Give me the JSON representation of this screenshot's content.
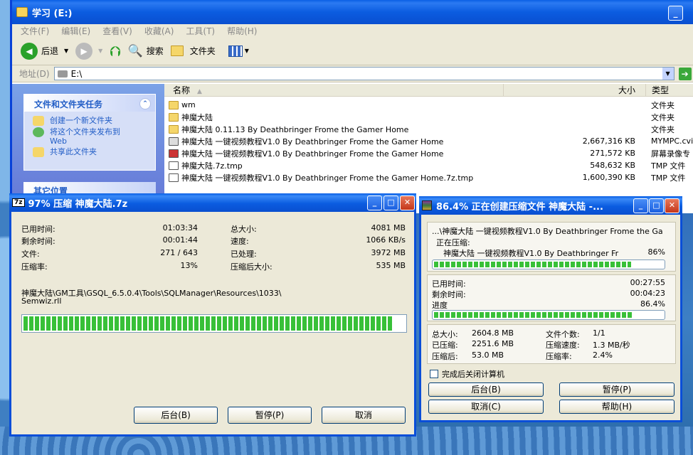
{
  "explorer": {
    "title": "学习 (E:)",
    "menu": [
      "文件(F)",
      "编辑(E)",
      "查看(V)",
      "收藏(A)",
      "工具(T)",
      "帮助(H)"
    ],
    "toolbar": {
      "back": "后退",
      "search": "搜索",
      "folders": "文件夹"
    },
    "address_label": "地址(D)",
    "address_value": "E:\\",
    "tasks": {
      "header": "文件和文件夹任务",
      "items": [
        "创建一个新文件夹",
        "将这个文件夹发布到 Web",
        "共享此文件夹"
      ]
    },
    "other_places": "其它位置",
    "columns": {
      "name": "名称",
      "size": "大小",
      "type": "类型"
    },
    "files": [
      {
        "name": "wm",
        "size": "",
        "type": "文件夹",
        "icon": "folder"
      },
      {
        "name": "神魔大陆",
        "size": "",
        "type": "文件夹",
        "icon": "folder"
      },
      {
        "name": "神魔大陆 0.11.13 By Deathbringer Frome the Gamer Home",
        "size": "",
        "type": "文件夹",
        "icon": "folder"
      },
      {
        "name": "神魔大陆 一键视频教程V1.0 By Deathbringer Frome the Gamer Home",
        "size": "2,667,316 KB",
        "type": "MYMPC.cvi",
        "icon": "video"
      },
      {
        "name": "神魔大陆 一键视频教程V1.0 By Deathbringer Frome the Gamer Home",
        "size": "271,572 KB",
        "type": "屏幕录像专",
        "icon": "video"
      },
      {
        "name": "神魔大陆.7z.tmp",
        "size": "548,632 KB",
        "type": "TMP 文件",
        "icon": "doc"
      },
      {
        "name": "神魔大陆 一键视频教程V1.0 By Deathbringer Frome the Gamer Home.7z.tmp",
        "size": "1,600,390 KB",
        "type": "TMP 文件",
        "icon": "doc"
      }
    ]
  },
  "sevenzip": {
    "title": "97% 压缩 神魔大陆.7z",
    "elapsed_label": "已用时间:",
    "elapsed": "01:03:34",
    "remaining_label": "剩余时间:",
    "remaining": "00:01:44",
    "files_label": "文件:",
    "files": "271 / 643",
    "ratio_label": "压缩率:",
    "ratio": "13%",
    "total_label": "总大小:",
    "total": "4081 MB",
    "speed_label": "速度:",
    "speed": "1066 KB/s",
    "processed_label": "已处理:",
    "processed": "3972 MB",
    "packed_label": "压缩后大小:",
    "packed": "535 MB",
    "path_line1": "神魔大陆\\GM工具\\GSQL_6.5.0.4\\Tools\\SQLManager\\Resources\\1033\\",
    "path_line2": "Semwiz.rll",
    "progress": 0.97,
    "btn_background": "后台(B)",
    "btn_pause": "暂停(P)",
    "btn_cancel": "取消"
  },
  "winrar": {
    "title": "86.4% 正在创建压缩文件 神魔大陆 -...",
    "archive_line": "...\\神魔大陆 一键视频教程V1.0 By Deathbringer Frome the Ga",
    "compressing_label": "正在压缩:",
    "current_file": "神魔大陆 一键视频教程V1.0 By Deathbringer Fr",
    "file_percent": "86%",
    "file_progress": 0.86,
    "elapsed_label": "已用时间:",
    "elapsed": "00:27:55",
    "remaining_label": "剩余时间:",
    "remaining": "00:04:23",
    "progress_label": "进度",
    "progress_text": "86.4%",
    "progress": 0.864,
    "total_label": "总大小:",
    "total": "2604.8 MB",
    "compressed_label": "已压缩:",
    "compressed": "2251.6 MB",
    "after_label": "压缩后:",
    "after": "53.0 MB",
    "count_label": "文件个数:",
    "count": "1/1",
    "speed_label": "压缩速度:",
    "speed": "1.3 MB/秒",
    "ratio_label": "压缩率:",
    "ratio": "2.4%",
    "shutdown_label": "完成后关闭计算机",
    "btn_background": "后台(B)",
    "btn_pause": "暂停(P)",
    "btn_cancel": "取消(C)",
    "btn_help": "帮助(H)"
  }
}
